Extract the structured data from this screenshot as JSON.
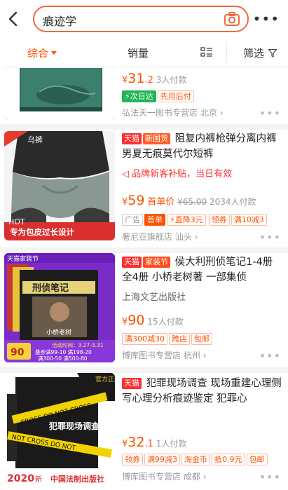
{
  "header": {
    "back_icon": "chevron-left-icon",
    "search_value": "痕迹学",
    "camera_icon": "camera-icon",
    "more_label": "•••"
  },
  "sortbar": {
    "tabs": [
      "综合",
      "销量"
    ],
    "filter_label": "筛选",
    "accent": "#ff5000"
  },
  "items": [
    {
      "price_int": "31",
      "price_dec": ".2",
      "sold": "3人付款",
      "tags": [
        "次日达",
        "先用后付"
      ],
      "shop": "弘法天一图书专营店",
      "location": "北京"
    },
    {
      "badge_platform": "天猫",
      "badge_extra": "新国货",
      "title": "阻复内裤枪弹分离内裤男夏无痕莫代尔短裤",
      "subsidy": "品牌新客补贴，当日有效",
      "price_int": "59",
      "price_label": "首单价",
      "orig_price": "¥65.00",
      "sold": "2034人付款",
      "pills": [
        "广告",
        "首单",
        "直降3元",
        "领券",
        "满10减3"
      ],
      "shop": "奢尼亚旗舰店",
      "location": "汕头",
      "thumb_text_top": "乌裤",
      "thumb_text_bottom": "专为包皮过长设计"
    },
    {
      "badge_platform": "天猫",
      "badge_extra": "家装节",
      "title": "侯大利刑侦笔记1-4册 全4册 小桥老树著 一部集侦",
      "publisher": "上海文艺出版社",
      "price_int": "90",
      "sold": "15人付款",
      "pills": [
        "满300减30",
        "跨店",
        "包邮"
      ],
      "shop": "博库图书专营店",
      "location": "杭州",
      "thumb_top": "天猫家装节",
      "thumb_title": "刑侦笔记",
      "thumb_date": "活动时间：3.27-3.31",
      "thumb_promo1": "叠券满99-10 满198-20",
      "thumb_promo2": "满300-50 满500-80",
      "thumb_price": "90"
    },
    {
      "badge_platform": "天猫",
      "title": "犯罪现场调查 现场重建心理侧写心理分析痕迹鉴定 犯罪心",
      "price_int": "32",
      "price_dec": ".1",
      "sold": "1人付款",
      "pills": [
        "领券",
        "满99减3",
        "淘金币",
        "抵0.9元",
        "包邮"
      ],
      "shop": "博库图书专营店",
      "location": "成都",
      "thumb_corner": "官方正版",
      "thumb_title": "犯罪现场调查",
      "thumb_year": "2020",
      "thumb_year_suffix": "新",
      "thumb_publisher": "中国法制出版社"
    }
  ]
}
